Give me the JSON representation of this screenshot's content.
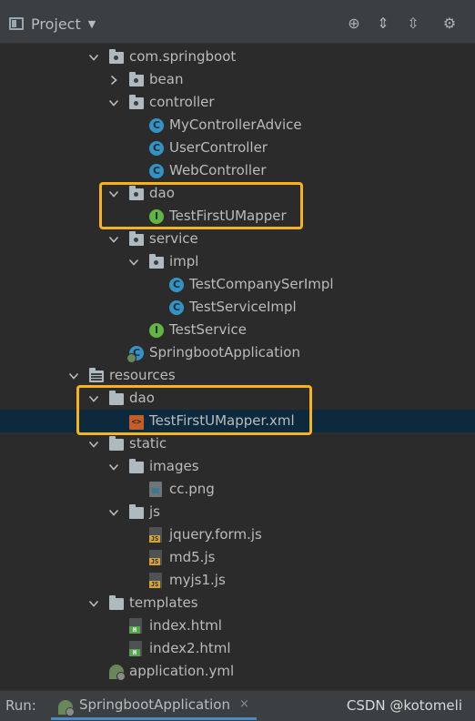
{
  "toolbar": {
    "title": "Project",
    "caret": "▼",
    "buttons": [
      {
        "name": "locate-icon",
        "glyph": "⊕"
      },
      {
        "name": "expand-all-icon",
        "glyph": "⇕"
      },
      {
        "name": "collapse-all-icon",
        "glyph": "⇳"
      },
      {
        "name": "gear-icon",
        "glyph": "⚙"
      }
    ]
  },
  "tree": [
    {
      "label": "com.springboot",
      "kind": "package",
      "open": true
    },
    {
      "label": "bean",
      "kind": "package",
      "open": false
    },
    {
      "label": "controller",
      "kind": "package",
      "open": true
    },
    {
      "label": "MyControllerAdvice",
      "kind": "class"
    },
    {
      "label": "UserController",
      "kind": "class"
    },
    {
      "label": "WebController",
      "kind": "class"
    },
    {
      "label": "dao",
      "kind": "package",
      "open": true
    },
    {
      "label": "TestFirstUMapper",
      "kind": "interface"
    },
    {
      "label": "service",
      "kind": "package",
      "open": true
    },
    {
      "label": "impl",
      "kind": "package",
      "open": true
    },
    {
      "label": "TestCompanySerImpl",
      "kind": "class"
    },
    {
      "label": "TestServiceImpl",
      "kind": "class"
    },
    {
      "label": "TestService",
      "kind": "interface"
    },
    {
      "label": "SpringbootApplication",
      "kind": "spring-class"
    },
    {
      "label": "resources",
      "kind": "resource-folder",
      "open": true
    },
    {
      "label": "dao",
      "kind": "folder",
      "open": true
    },
    {
      "label": "TestFirstUMapper.xml",
      "kind": "xml",
      "selected": true
    },
    {
      "label": "static",
      "kind": "folder",
      "open": true
    },
    {
      "label": "images",
      "kind": "folder",
      "open": true
    },
    {
      "label": "cc.png",
      "kind": "png"
    },
    {
      "label": "js",
      "kind": "folder",
      "open": true
    },
    {
      "label": "jquery.form.js",
      "kind": "js"
    },
    {
      "label": "md5.js",
      "kind": "js"
    },
    {
      "label": "myjs1.js",
      "kind": "js"
    },
    {
      "label": "templates",
      "kind": "folder",
      "open": true
    },
    {
      "label": "index.html",
      "kind": "html"
    },
    {
      "label": "index2.html",
      "kind": "html"
    },
    {
      "label": "application.yml",
      "kind": "yml"
    }
  ],
  "icon_badges": {
    "class": "C",
    "interface": "I",
    "xml": "<>",
    "js": "JS",
    "html": "H"
  },
  "colors": {
    "highlight": "#f5b41e",
    "selected_row": "#0d293e",
    "class_icon": "#3592c4",
    "interface_icon": "#62b543"
  },
  "status": {
    "run_label": "Run:",
    "run_tab_label": "SpringbootApplication",
    "run_tab_close": "×",
    "watermark": "CSDN @kotomeli"
  }
}
